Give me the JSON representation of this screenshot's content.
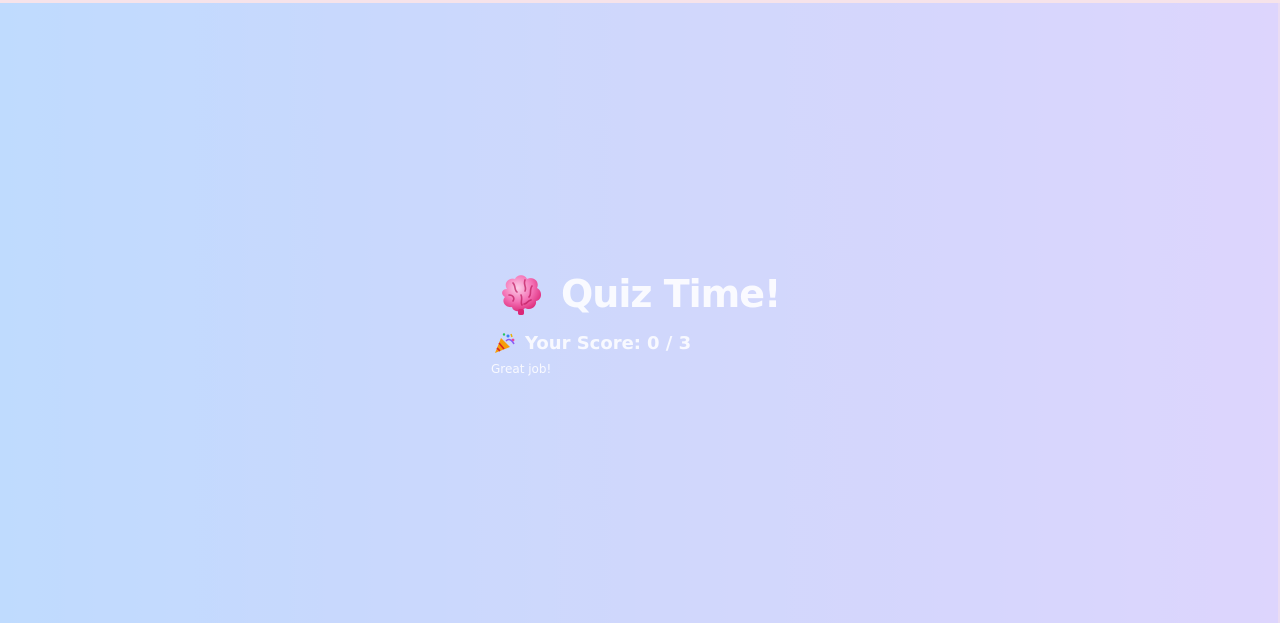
{
  "quiz": {
    "title": "Quiz Time!",
    "title_icon": "brain-icon",
    "score_icon": "party-popper-icon",
    "score_label": "Your Score:",
    "score_value": "0 / 3",
    "message": "Great job!"
  },
  "colors": {
    "gradient_start": "#bfdbfe",
    "gradient_end": "#ddd5fd",
    "text": "#ffffff",
    "brain": "#f472b6"
  }
}
